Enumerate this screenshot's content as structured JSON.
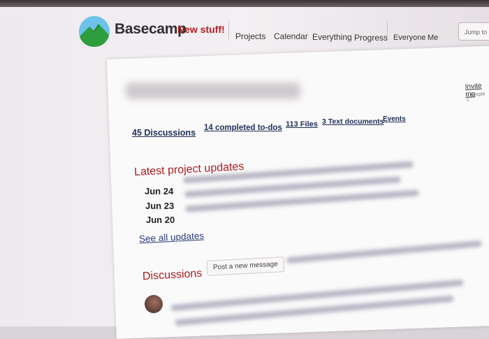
{
  "header": {
    "brand": "Basecamp",
    "new_stuff": "New stuff!",
    "nav": [
      "Projects",
      "Calendar",
      "Everything",
      "Progress"
    ],
    "nav_right": [
      "Everyone",
      "Me"
    ],
    "search_placeholder": "Jump to"
  },
  "project": {
    "invite": "Invite mo",
    "invite_sub": "7 people c",
    "tabs": [
      "45 Discussions",
      "14 completed to-dos",
      "113 Files",
      "3 Text documents",
      "Events"
    ]
  },
  "updates": {
    "heading": "Latest project updates",
    "dates": [
      "Jun 24",
      "Jun 23",
      "Jun 20"
    ],
    "see_all": "See all updates"
  },
  "discussions": {
    "heading": "Discussions",
    "post_button": "Post a new message"
  },
  "colors": {
    "accent_red": "#a81e1e",
    "link_blue": "#1f2d55"
  }
}
